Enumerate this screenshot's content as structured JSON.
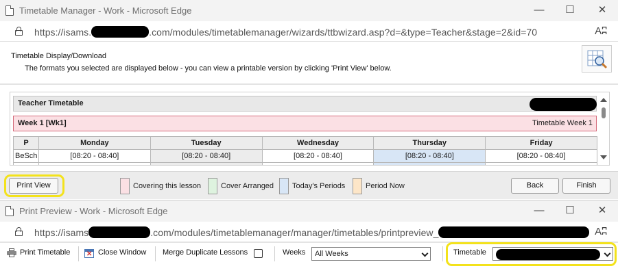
{
  "window1": {
    "title": "Timetable Manager - Work - Microsoft Edge",
    "url_prefix": "https://isams.",
    "url_suffix": ".com/modules/timetablemanager/wizards/ttbwizard.asp?d=&type=Teacher&stage=2&id=70",
    "controls": {
      "minimize": "—",
      "maximize": "☐",
      "close": "✕"
    },
    "read_aloud_glyph": "Aʭ",
    "header_title": "Timetable Display/Download",
    "header_subtitle": "The formats you selected are displayed below - you can view a printable version by clicking 'Print View' below.",
    "timetable": {
      "heading": "Teacher Timetable",
      "week_label": "Week 1 [Wk1]",
      "week_right": "Timetable Week 1",
      "columns": [
        "P",
        "Monday",
        "Tuesday",
        "Wednesday",
        "Thursday",
        "Friday"
      ],
      "rows": [
        {
          "period": "BeSch",
          "cells": [
            "[08:20 - 08:40]",
            "[08:20 - 08:40]",
            "[08:20 - 08:40]",
            "[08:20 - 08:40]",
            "[08:20 - 08:40]"
          ]
        }
      ]
    },
    "footer": {
      "print_view": "Print View",
      "legend": [
        {
          "label": "Covering this lesson",
          "color": "#fbe0e4"
        },
        {
          "label": "Cover Arranged",
          "color": "#def3df"
        },
        {
          "label": "Today's Periods",
          "color": "#d8e6f6"
        },
        {
          "label": "Period Now",
          "color": "#fde6c8"
        }
      ],
      "back": "Back",
      "finish": "Finish"
    }
  },
  "window2": {
    "title": "Print Preview - Work - Microsoft Edge",
    "url_prefix": "https://isams",
    "url_suffix": ".com/modules/timetablemanager/manager/timetables/printpreview_",
    "controls": {
      "minimize": "—",
      "maximize": "☐",
      "close": "✕"
    },
    "read_aloud_glyph": "Aʭ",
    "toolbar": {
      "print_timetable": "Print Timetable",
      "close_window": "Close Window",
      "merge_label": "Merge Duplicate Lessons",
      "merge_checked": false,
      "weeks_label": "Weeks",
      "weeks_value": "All Weeks",
      "timetable_label": "Timetable"
    }
  },
  "colors": {
    "highlight": "#f3e21b",
    "titlebar": "#f3f3f3"
  }
}
